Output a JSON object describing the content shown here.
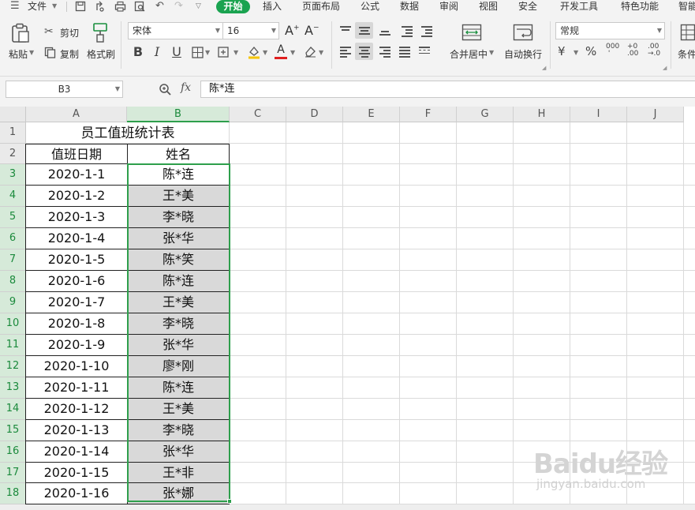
{
  "menubar": {
    "file_menu": "文件",
    "tabs": [
      "开始",
      "插入",
      "页面布局",
      "公式",
      "数据",
      "审阅",
      "视图",
      "安全",
      "开发工具",
      "特色功能",
      "智能"
    ],
    "active_tab": "开始"
  },
  "ribbon": {
    "paste_label": "粘贴",
    "cut_label": "剪切",
    "copy_label": "复制",
    "format_painter_label": "格式刷",
    "font_name": "宋体",
    "font_size": "16",
    "merge_center_label": "合并居中",
    "wrap_text_label": "自动换行",
    "number_format": "常规",
    "conditional_label": "条件"
  },
  "formula_bar": {
    "name_box": "B3",
    "fx_label": "fx",
    "formula_value": "陈*连"
  },
  "grid": {
    "columns": [
      "A",
      "B",
      "C",
      "D",
      "E",
      "F",
      "G",
      "H",
      "I",
      "J"
    ],
    "selected_column": "B",
    "title": "员工值班统计表",
    "headers": [
      "值班日期",
      "姓名"
    ],
    "rows": [
      {
        "row": "1"
      },
      {
        "row": "2"
      },
      {
        "row": "3",
        "date": "2020-1-1",
        "name": "陈*连"
      },
      {
        "row": "4",
        "date": "2020-1-2",
        "name": "王*美"
      },
      {
        "row": "5",
        "date": "2020-1-3",
        "name": "李*晓"
      },
      {
        "row": "6",
        "date": "2020-1-4",
        "name": "张*华"
      },
      {
        "row": "7",
        "date": "2020-1-5",
        "name": "陈*笑"
      },
      {
        "row": "8",
        "date": "2020-1-6",
        "name": "陈*连"
      },
      {
        "row": "9",
        "date": "2020-1-7",
        "name": "王*美"
      },
      {
        "row": "10",
        "date": "2020-1-8",
        "name": "李*晓"
      },
      {
        "row": "11",
        "date": "2020-1-9",
        "name": "张*华"
      },
      {
        "row": "12",
        "date": "2020-1-10",
        "name": "廖*刚"
      },
      {
        "row": "13",
        "date": "2020-1-11",
        "name": "陈*连"
      },
      {
        "row": "14",
        "date": "2020-1-12",
        "name": "王*美"
      },
      {
        "row": "15",
        "date": "2020-1-13",
        "name": "李*晓"
      },
      {
        "row": "16",
        "date": "2020-1-14",
        "name": "张*华"
      },
      {
        "row": "17",
        "date": "2020-1-15",
        "name": "王*非"
      },
      {
        "row": "18",
        "date": "2020-1-16",
        "name": "张*娜"
      }
    ]
  },
  "watermark": {
    "brand": "Baidu经验",
    "url": "jingyan.baidu.com"
  },
  "colors": {
    "accent_green": "#1aa350",
    "selection_border": "#2e9f4c",
    "cell_shade": "#d9d9d9"
  }
}
